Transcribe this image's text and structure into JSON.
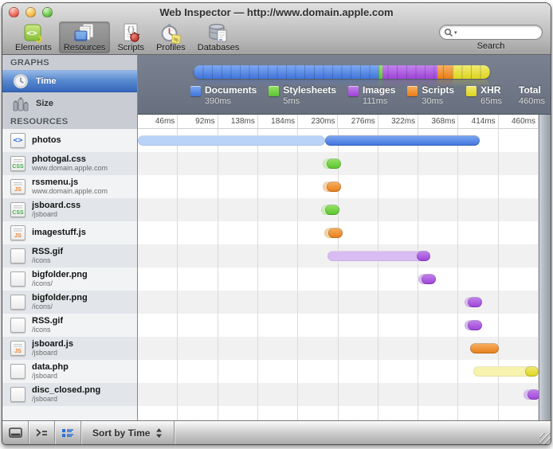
{
  "window": {
    "title": "Web Inspector — http://www.domain.apple.com"
  },
  "toolbar": {
    "buttons": [
      {
        "label": "Elements",
        "selected": false
      },
      {
        "label": "Resources",
        "selected": true
      },
      {
        "label": "Scripts",
        "selected": false
      },
      {
        "label": "Profiles",
        "selected": false
      },
      {
        "label": "Databases",
        "selected": false
      }
    ],
    "search": {
      "label": "Search",
      "placeholder": "",
      "value": ""
    }
  },
  "sidebar": {
    "graphs_header": "GRAPHS",
    "graph_items": [
      {
        "label": "Time",
        "selected": true
      },
      {
        "label": "Size",
        "selected": false
      }
    ],
    "resources_header": "RESOURCES"
  },
  "status_bar": {
    "sort_label": "Sort by Time"
  },
  "chart_data": {
    "type": "timeline",
    "unit": "ms",
    "axis_max_ms": 460,
    "tick_interval_ms": 46,
    "axis_ticks": [
      "46ms",
      "92ms",
      "138ms",
      "184ms",
      "230ms",
      "276ms",
      "322ms",
      "368ms",
      "414ms",
      "460ms"
    ],
    "legend": [
      {
        "label": "Documents",
        "value": "390ms",
        "color": "#3f74dc",
        "color_light": "#7ea9f2"
      },
      {
        "label": "Stylesheets",
        "value": "5ms",
        "color": "#59c32e",
        "color_light": "#97e468"
      },
      {
        "label": "Images",
        "value": "111ms",
        "color": "#9f43d8",
        "color_light": "#c283ec"
      },
      {
        "label": "Scripts",
        "value": "30ms",
        "color": "#e87d18",
        "color_light": "#f7b163"
      },
      {
        "label": "XHR",
        "value": "65ms",
        "color": "#ddd51e",
        "color_light": "#f0ea72"
      },
      {
        "label": "Total",
        "value": "460ms",
        "color": null,
        "color_light": null
      }
    ],
    "overview_segments": [
      {
        "category": "documents",
        "fraction": 0.623
      },
      {
        "category": "stylesheets",
        "fraction": 0.014
      },
      {
        "category": "images",
        "fraction": 0.186
      },
      {
        "category": "scripts",
        "fraction": 0.05
      },
      {
        "category": "xhr",
        "fraction": 0.127
      }
    ],
    "category_colors": {
      "documents": {
        "solid": "#3f74dc",
        "solid_light": "#7ea9f2",
        "latency": "#b9d2f8"
      },
      "stylesheets": {
        "solid": "#59c32e",
        "solid_light": "#97e468",
        "latency": "#cdeeb8"
      },
      "images": {
        "solid": "#9f43d8",
        "solid_light": "#c283ec",
        "latency": "#d9bcf2"
      },
      "scripts": {
        "solid": "#e87d18",
        "solid_light": "#f7b163",
        "latency": "#f8d4a4"
      },
      "xhr": {
        "solid": "#ddd51e",
        "solid_light": "#f0ea72",
        "latency": "#f7f3ae"
      }
    },
    "rows": [
      {
        "name": "photos",
        "subtitle": "",
        "icon": "html",
        "category": "documents",
        "latency": [
          0,
          215
        ],
        "solid": [
          215,
          392
        ]
      },
      {
        "name": "photogal.css",
        "subtitle": "www.domain.apple.com",
        "icon": "css",
        "category": "stylesheets",
        "latency": [
          212,
          228
        ],
        "solid": [
          217,
          233
        ]
      },
      {
        "name": "rssmenu.js",
        "subtitle": "www.domain.apple.com",
        "icon": "js",
        "category": "scripts",
        "latency": [
          212,
          228
        ],
        "solid": [
          217,
          233
        ]
      },
      {
        "name": "jsboard.css",
        "subtitle": "/jsboard",
        "icon": "css",
        "category": "stylesheets",
        "latency": [
          210,
          226
        ],
        "solid": [
          215,
          231
        ]
      },
      {
        "name": "imagestuff.js",
        "subtitle": "",
        "icon": "js",
        "category": "scripts",
        "latency": [
          214,
          230
        ],
        "solid": [
          219,
          235
        ]
      },
      {
        "name": "RSS.gif",
        "subtitle": "/icons",
        "icon": "blank",
        "category": "images",
        "latency": [
          218,
          333
        ],
        "solid": [
          320,
          336
        ]
      },
      {
        "name": "bigfolder.png",
        "subtitle": "/icons/",
        "icon": "blank",
        "category": "images",
        "latency": [
          322,
          338
        ],
        "solid": [
          326,
          342
        ]
      },
      {
        "name": "bigfolder.png",
        "subtitle": "/icons/",
        "icon": "blank",
        "category": "images",
        "latency": [
          375,
          391
        ],
        "solid": [
          379,
          395
        ]
      },
      {
        "name": "RSS.gif",
        "subtitle": "/icons",
        "icon": "blank",
        "category": "images",
        "latency": [
          375,
          391
        ],
        "solid": [
          379,
          395
        ]
      },
      {
        "name": "jsboard.js",
        "subtitle": "/jsboard",
        "icon": "js",
        "category": "scripts",
        "latency": null,
        "solid": [
          381,
          414
        ]
      },
      {
        "name": "data.php",
        "subtitle": "/jsboard",
        "icon": "blank",
        "category": "xhr",
        "latency": [
          385,
          458
        ],
        "solid": [
          444,
          460
        ]
      },
      {
        "name": "disc_closed.png",
        "subtitle": "/jsboard",
        "icon": "blank",
        "category": "images",
        "latency": [
          443,
          459
        ],
        "solid": [
          447,
          462
        ]
      }
    ]
  }
}
